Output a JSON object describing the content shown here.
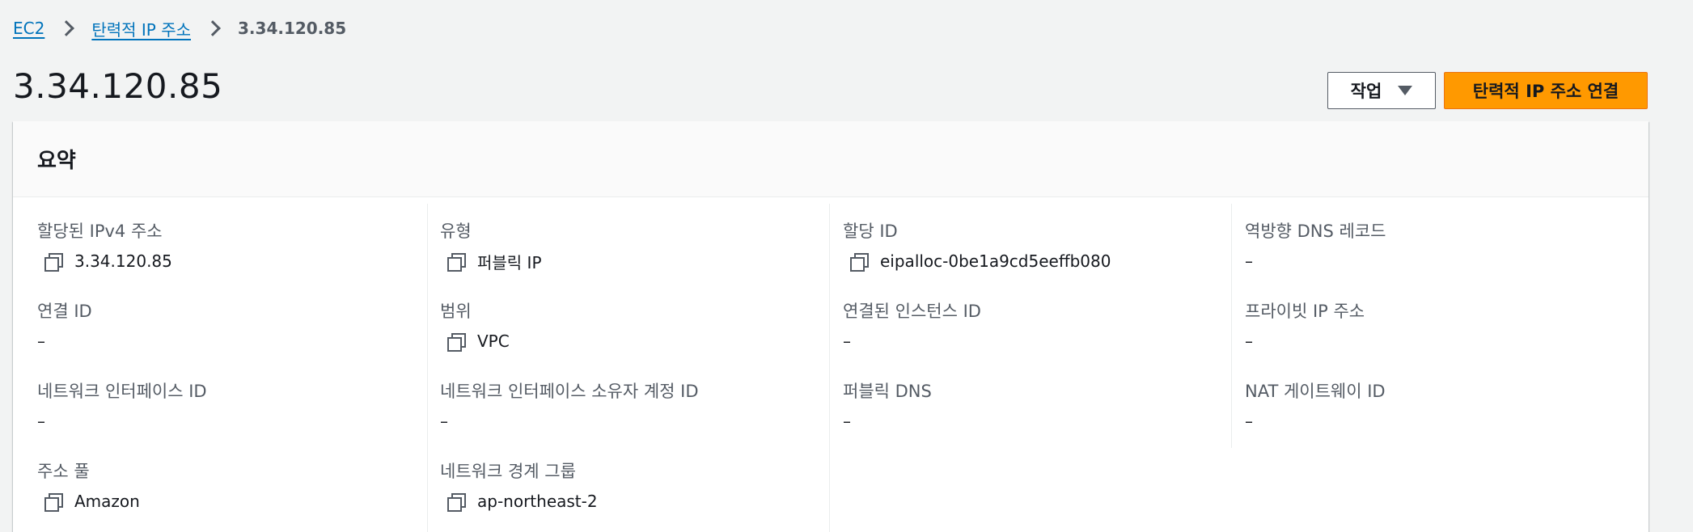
{
  "breadcrumb": {
    "items": [
      "EC2",
      "탄력적 IP 주소"
    ],
    "current": "3.34.120.85"
  },
  "header": {
    "title": "3.34.120.85",
    "actions_label": "작업",
    "primary_label": "탄력적 IP 주소 연결"
  },
  "colors": {
    "primary_button": "#ff9900",
    "link": "#0073bb",
    "page_background": "#f2f3f3"
  },
  "summary": {
    "title": "요약",
    "fields": {
      "allocated_ipv4": {
        "label": "할당된 IPv4 주소",
        "value": "3.34.120.85",
        "copyable": true
      },
      "type": {
        "label": "유형",
        "value": "퍼블릭 IP",
        "copyable": true
      },
      "allocation_id": {
        "label": "할당 ID",
        "value": "eipalloc-0be1a9cd5eeffb080",
        "copyable": true
      },
      "reverse_dns": {
        "label": "역방향 DNS 레코드",
        "value": "–",
        "copyable": false
      },
      "association_id": {
        "label": "연결 ID",
        "value": "–",
        "copyable": false
      },
      "scope": {
        "label": "범위",
        "value": "VPC",
        "copyable": true
      },
      "associated_instance_id": {
        "label": "연결된 인스턴스 ID",
        "value": "–",
        "copyable": false
      },
      "private_ip": {
        "label": "프라이빗 IP 주소",
        "value": "–",
        "copyable": false
      },
      "network_interface_id": {
        "label": "네트워크 인터페이스 ID",
        "value": "–",
        "copyable": false
      },
      "network_interface_owner": {
        "label": "네트워크 인터페이스 소유자 계정 ID",
        "value": "–",
        "copyable": false
      },
      "public_dns": {
        "label": "퍼블릭 DNS",
        "value": "–",
        "copyable": false
      },
      "nat_gateway_id": {
        "label": "NAT 게이트웨이 ID",
        "value": "–",
        "copyable": false
      },
      "address_pool": {
        "label": "주소 풀",
        "value": "Amazon",
        "copyable": true
      },
      "network_border_group": {
        "label": "네트워크 경계 그룹",
        "value": "ap-northeast-2",
        "copyable": true
      }
    }
  }
}
